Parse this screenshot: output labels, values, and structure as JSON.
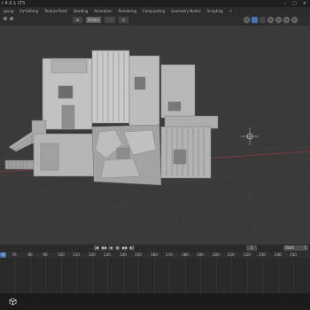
{
  "window": {
    "title": "r 4.0.1 LTS",
    "controls": [
      "–",
      "□",
      "×"
    ]
  },
  "workspace_tabs": [
    "pping",
    "UV Editing",
    "Texture Paint",
    "Shading",
    "Animation",
    "Rendering",
    "Compositing",
    "Geometry Nodes",
    "Scripting",
    "+"
  ],
  "header": {
    "transform_orientation": "Global",
    "pivot_label": "⊕",
    "snap_label": "⋮⋮",
    "proportional_label": "⊙"
  },
  "timeline": {
    "start_label": "Start",
    "start_value": "1",
    "current_frame": "1",
    "playhead_label": "0",
    "ruler_labels": [
      "70",
      "80",
      "90",
      "100",
      "110",
      "120",
      "130",
      "140",
      "150",
      "160",
      "170",
      "180",
      "190",
      "200",
      "210",
      "220",
      "230",
      "240",
      "250"
    ],
    "playback_buttons": [
      "|◀",
      "◀◀",
      "◀",
      "▶",
      "▶▶",
      "▶|"
    ]
  },
  "colors": {
    "accent": "#4772b3",
    "viewport_bg": "#3a3a3a",
    "grid_red": "#8a3a3a",
    "grid_green": "#5e7a2e",
    "model": "#bdbdbd"
  },
  "icons": {
    "taskbar": "cube-icon",
    "active_overlay": "overlay-icon"
  }
}
